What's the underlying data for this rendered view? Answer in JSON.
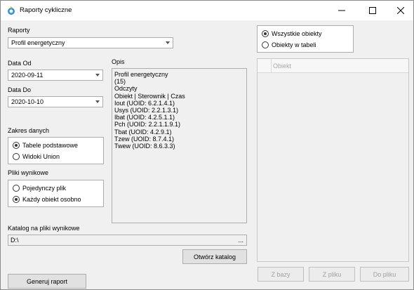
{
  "window": {
    "title": "Raporty cykliczne"
  },
  "reports": {
    "label": "Raporty",
    "selected": "Profil energetyczny"
  },
  "date_from": {
    "label": "Data Od",
    "value": "2020-09-11"
  },
  "date_to": {
    "label": "Data Do",
    "value": "2020-10-10"
  },
  "data_range": {
    "label": "Zakres danych",
    "options": [
      "Tabele podstawowe",
      "Widoki Union"
    ],
    "selected_index": 0
  },
  "output_files": {
    "label": "Pliki wynikowe",
    "options": [
      "Pojedynczy plik",
      "Każdy obiekt osobno"
    ],
    "selected_index": 1
  },
  "description": {
    "label": "Opis",
    "lines": [
      "Profil energetyczny",
      "(15)",
      "Odczyty",
      "Obiekt | Sterownik | Czas",
      "Iout (UOID: 6.2.1.4.1)",
      "Usys (UOID: 2.2.1.3.1)",
      "Ibat (UOID: 4.2.5.1.1)",
      "Pch (UOID: 2.2.1.1.9.1)",
      "Tbat (UOID: 4.2.9.1)",
      "Tzew (UOID: 8.7.4.1)",
      "Twew (UOID: 8.6.3.3)"
    ]
  },
  "output_dir": {
    "label": "Katalog na pliki wynikowe",
    "value": "D:\\",
    "browse": "..."
  },
  "buttons": {
    "open_dir": "Otwórz katalog",
    "generate": "Generuj raport",
    "from_db": "Z bazy",
    "from_file": "Z pliku",
    "to_file": "Do pliku"
  },
  "objects": {
    "options": [
      "Wszystkie obiekty",
      "Obiekty w tabeli"
    ],
    "selected_index": 0,
    "column": "Obiekt"
  }
}
